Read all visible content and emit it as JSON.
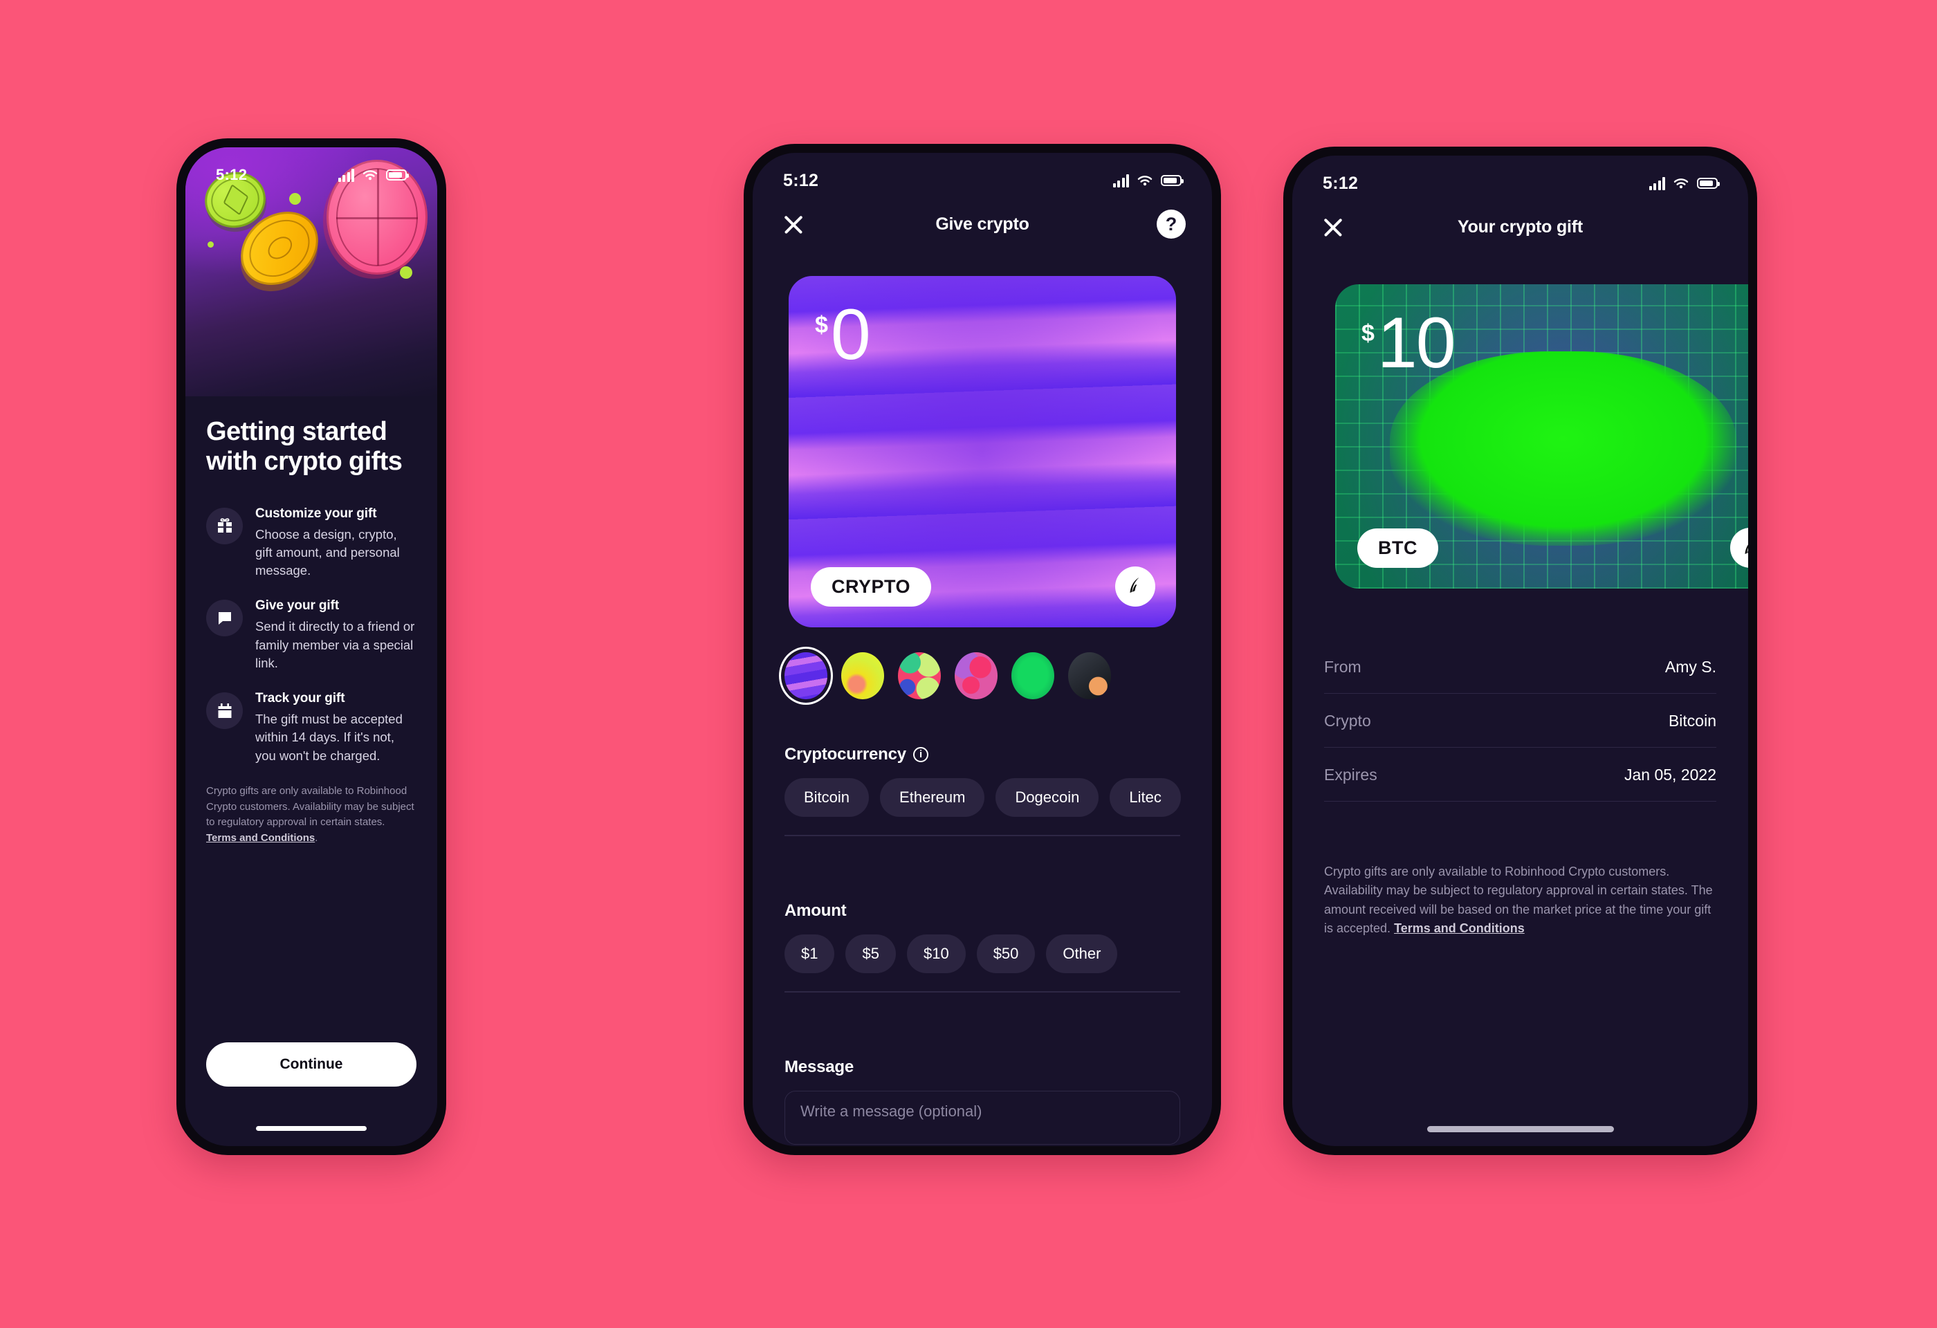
{
  "background_color": "#FB5578",
  "status_bar": {
    "time": "5:12",
    "icons": [
      "cellular-signal-icon",
      "wifi-icon",
      "battery-icon"
    ]
  },
  "phone1": {
    "title": "Getting started with crypto gifts",
    "features": [
      {
        "icon": "gift-icon",
        "title": "Customize your gift",
        "body": "Choose a design, crypto, gift amount, and personal message."
      },
      {
        "icon": "chat-bubble-icon",
        "title": "Give your gift",
        "body": "Send it directly to a friend or family member via a special link."
      },
      {
        "icon": "calendar-icon",
        "title": "Track your gift",
        "body": "The gift must be accepted within 14 days. If it's not, you won't be charged."
      }
    ],
    "disclaimer": "Crypto gifts are only available to Robinhood Crypto customers. Availability may be subject to regulatory approval in certain states. ",
    "disclaimer_link": "Terms and Conditions",
    "disclaimer_tail": ".",
    "continue_label": "Continue"
  },
  "phone2": {
    "nav": {
      "close": "close-icon",
      "title": "Give crypto",
      "help": "?"
    },
    "card": {
      "currency_symbol": "$",
      "amount": "0",
      "pill_label": "CRYPTO",
      "logo": "robinhood-feather-icon"
    },
    "designs": [
      {
        "name": "purple-stripes",
        "selected": true
      },
      {
        "name": "yellow-abstract",
        "selected": false
      },
      {
        "name": "pink-green-shapes",
        "selected": false
      },
      {
        "name": "pink-purple-blob",
        "selected": false
      },
      {
        "name": "green-grid",
        "selected": false
      },
      {
        "name": "doge-photo",
        "selected": false
      }
    ],
    "crypto": {
      "label": "Cryptocurrency",
      "info_icon": "info-icon",
      "options": [
        "Bitcoin",
        "Ethereum",
        "Dogecoin",
        "Litec"
      ]
    },
    "amount": {
      "label": "Amount",
      "options": [
        "$1",
        "$5",
        "$10",
        "$50",
        "Other"
      ]
    },
    "message": {
      "label": "Message",
      "placeholder": "Write a message (optional)",
      "value": ""
    }
  },
  "phone3": {
    "nav": {
      "close": "close-icon",
      "title": "Your crypto gift"
    },
    "card": {
      "currency_symbol": "$",
      "amount": "10",
      "pill_label": "BTC",
      "logo": "robinhood-feather-icon"
    },
    "details": [
      {
        "key": "From",
        "value": "Amy S."
      },
      {
        "key": "Crypto",
        "value": "Bitcoin"
      },
      {
        "key": "Expires",
        "value": "Jan 05, 2022"
      }
    ],
    "disclaimer": "Crypto gifts are only available to Robinhood Crypto customers. Availability may be subject to regulatory approval in certain states. The amount received will be based on the market price at the time your gift is accepted. ",
    "disclaimer_link": "Terms and Conditions"
  }
}
